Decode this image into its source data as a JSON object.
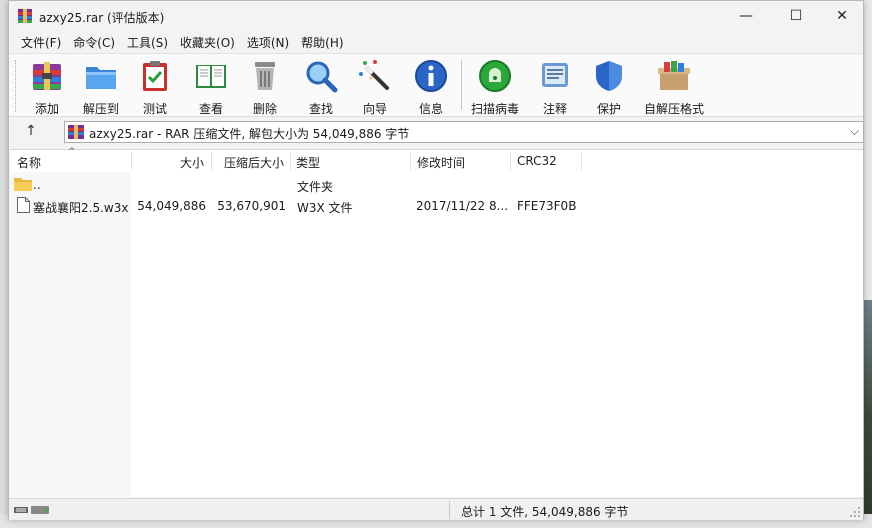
{
  "window": {
    "title": "azxy25.rar (评估版本)",
    "min_glyph": "—",
    "max_glyph": "☐",
    "close_glyph": "✕"
  },
  "menu": [
    "文件(F)",
    "命令(C)",
    "工具(S)",
    "收藏夹(O)",
    "选项(N)",
    "帮助(H)"
  ],
  "toolbar": [
    {
      "label": "添加",
      "icon": "winrar-add-icon"
    },
    {
      "label": "解压到",
      "icon": "folder-extract-icon"
    },
    {
      "label": "测试",
      "icon": "test-clipboard-icon"
    },
    {
      "label": "查看",
      "icon": "book-view-icon"
    },
    {
      "label": "删除",
      "icon": "trash-icon"
    },
    {
      "label": "查找",
      "icon": "magnifier-icon"
    },
    {
      "label": "向导",
      "icon": "wizard-wand-icon"
    },
    {
      "label": "信息",
      "icon": "info-icon"
    },
    {
      "label": "扫描病毒",
      "icon": "virus-scan-icon"
    },
    {
      "label": "注释",
      "icon": "comment-icon"
    },
    {
      "label": "保护",
      "icon": "shield-icon"
    },
    {
      "label": "自解压格式",
      "icon": "sfx-box-icon"
    }
  ],
  "address": {
    "up_glyph": "↑",
    "text": "azxy25.rar - RAR 压缩文件, 解包大小为 54,049,886 字节",
    "dropdown_glyph": "⌵"
  },
  "columns": {
    "name": "名称",
    "size": "大小",
    "packed": "压缩后大小",
    "type": "类型",
    "modified": "修改时间",
    "crc": "CRC32"
  },
  "rows": [
    {
      "name": "..",
      "size": "",
      "packed": "",
      "type": "文件夹",
      "modified": "",
      "crc": "",
      "icon": "folder-icon"
    },
    {
      "name": "塞战襄阳2.5.w3x",
      "size": "54,049,886",
      "packed": "53,670,901",
      "type": "W3X 文件",
      "modified": "2017/11/22 8...",
      "crc": "FFE73F0B",
      "icon": "file-icon"
    }
  ],
  "status": {
    "summary": "总计 1 文件, 54,049,886 字节"
  },
  "colors": {
    "accent": "#2a5fb0",
    "window_bg": "#f3f3f3"
  }
}
